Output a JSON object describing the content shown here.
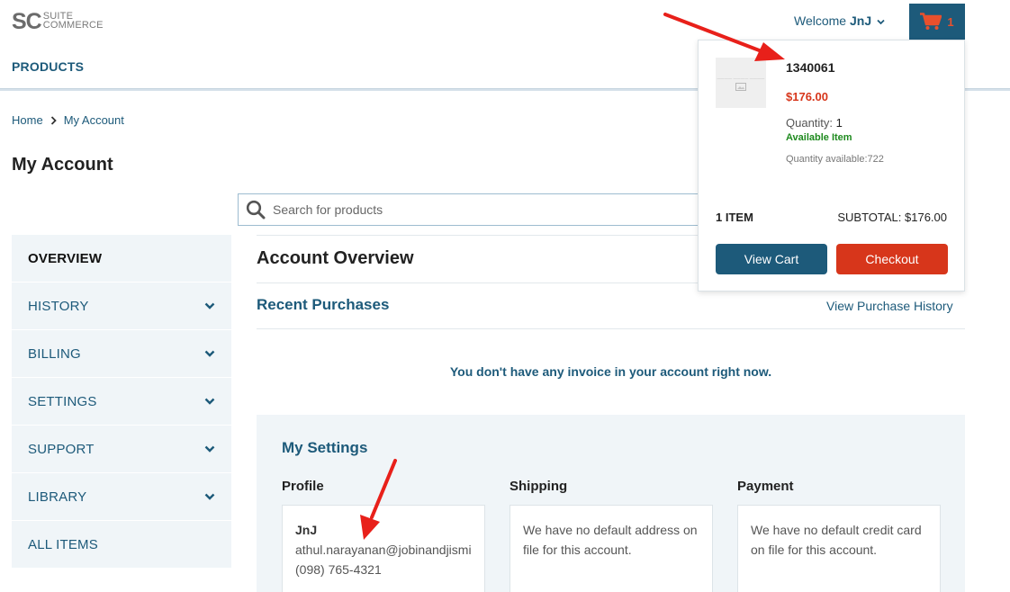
{
  "header": {
    "logo_mark": "SC",
    "logo_line1": "SUITE",
    "logo_line2": "COMMERCE",
    "nav_products": "PRODUCTS",
    "welcome_prefix": "Welcome",
    "welcome_user": "JnJ",
    "cart_count": "1"
  },
  "breadcrumb": {
    "home": "Home",
    "current": "My Account"
  },
  "page_title": "My Account",
  "search": {
    "placeholder": "Search for products",
    "value": ""
  },
  "sidebar": {
    "items": [
      {
        "label": "OVERVIEW",
        "expandable": false
      },
      {
        "label": "HISTORY",
        "expandable": true
      },
      {
        "label": "BILLING",
        "expandable": true
      },
      {
        "label": "SETTINGS",
        "expandable": true
      },
      {
        "label": "SUPPORT",
        "expandable": true
      },
      {
        "label": "LIBRARY",
        "expandable": true
      },
      {
        "label": "ALL ITEMS",
        "expandable": false
      }
    ]
  },
  "main": {
    "overview_title": "Account Overview",
    "recent_purchases_title": "Recent Purchases",
    "view_purchase_history": "View Purchase History",
    "no_invoice_msg": "You don't have any invoice in your account right now.",
    "settings": {
      "title": "My Settings",
      "profile_label": "Profile",
      "shipping_label": "Shipping",
      "payment_label": "Payment",
      "profile_name": "JnJ",
      "profile_email": "athul.narayanan@jobinandjismi",
      "profile_phone": "(098) 765-4321",
      "shipping_text": "We have no default address on file for this account.",
      "payment_text": "We have no default credit card on file for this account."
    }
  },
  "mini_cart": {
    "item_sku": "1340061",
    "item_price": "$176.00",
    "quantity_label": "Quantity:",
    "quantity_value": "1",
    "availability": "Available Item",
    "quantity_available": "Quantity available:722",
    "items_count": "1 ITEM",
    "subtotal": "SUBTOTAL: $176.00",
    "view_cart_label": "View Cart",
    "checkout_label": "Checkout"
  },
  "colors": {
    "brand_blue": "#1d5a7a",
    "accent_red": "#d7361b",
    "available_green": "#1e8a1e",
    "sidebar_bg": "#f0f5f8",
    "annotation_arrow": "#e8201a"
  },
  "icons": [
    "search-icon",
    "cart-icon",
    "chevron-down-icon",
    "chevron-right-icon",
    "image-placeholder-icon"
  ]
}
